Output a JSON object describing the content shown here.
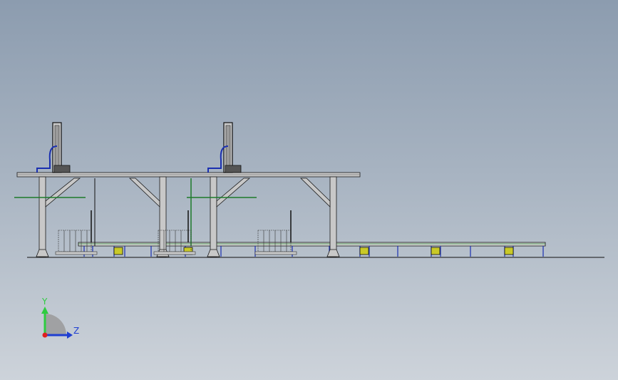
{
  "triad": {
    "y_label": "Y",
    "z_label": "Z",
    "y_color": "#2ecc40",
    "z_color": "#1f3fd1",
    "origin_color": "#e02020"
  },
  "colors": {
    "steel": "#c8c8c8",
    "outline": "#1a1a1a",
    "pipe_blue": "#1a2fb0",
    "rail_green": "#1d7a2a",
    "motor_yellow": "#c9c928"
  }
}
